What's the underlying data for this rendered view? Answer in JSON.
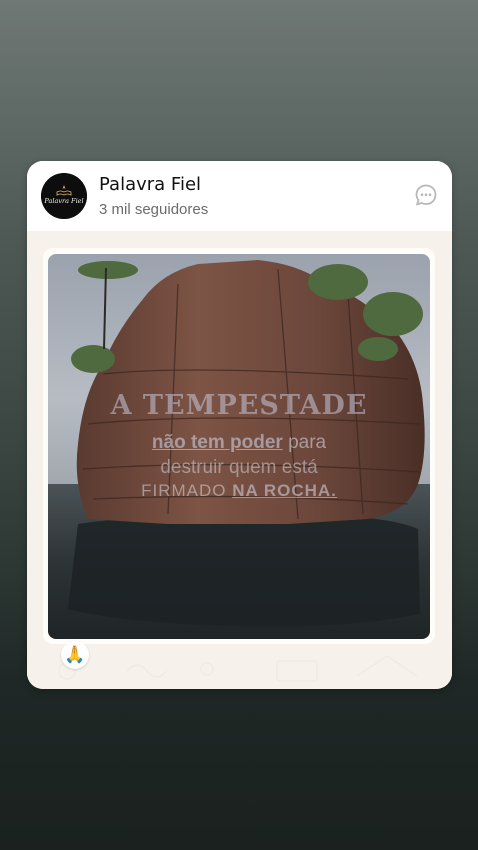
{
  "channel": {
    "name": "Palavra Fiel",
    "followers": "3 mil seguidores",
    "avatar_text": "Palavra Fiel"
  },
  "post": {
    "image_text": {
      "line1": "A TEMPESTADE",
      "line2_bold": "não tem poder",
      "line2_rest": " para",
      "line3": "destruir quem está",
      "line4_plain": "FIRMADO ",
      "line4_bold": "NA ROCHA."
    },
    "reaction_emoji": "🙏"
  },
  "icons": {
    "chat": "chat-bubble-icon"
  },
  "colors": {
    "background_top": "#6f7875",
    "background_bottom": "#1a211f",
    "card": "#ffffff",
    "chat_bg": "#f6f1ea"
  }
}
